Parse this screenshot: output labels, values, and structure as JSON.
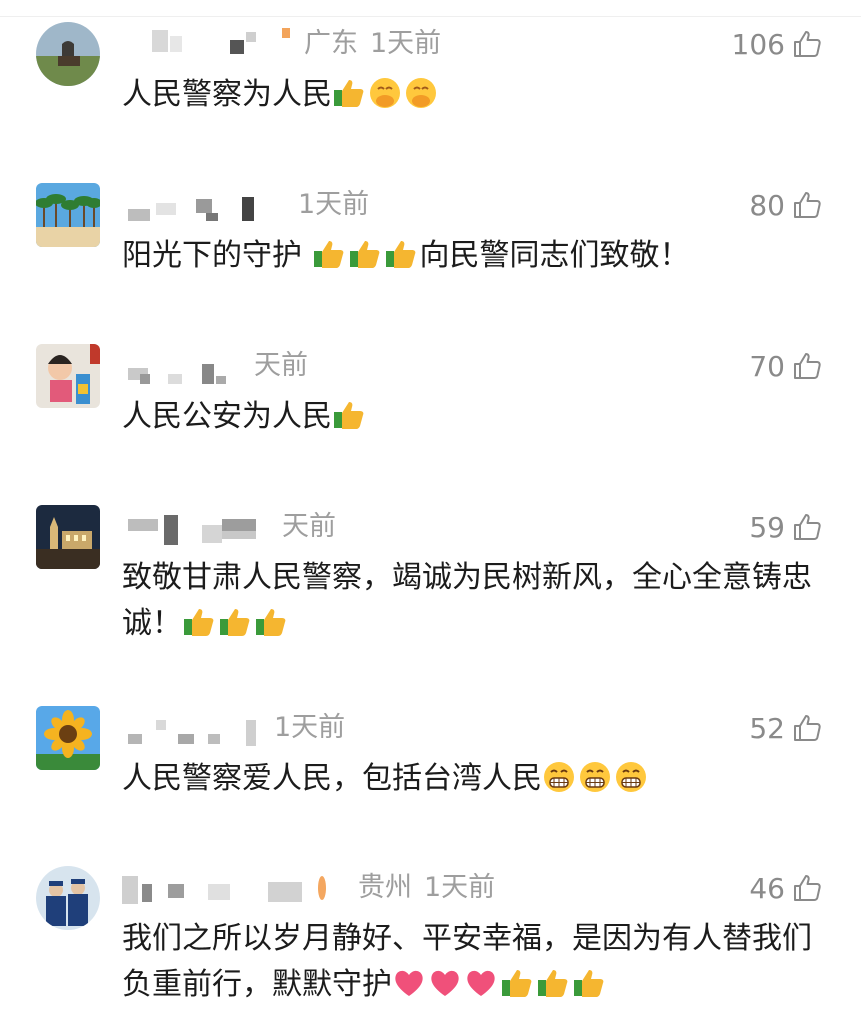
{
  "comments": [
    {
      "location": "广东",
      "time": "1天前",
      "likes": "106",
      "text": "人民警察为人民",
      "emojis": [
        "thumbs-up",
        "face-with-hand-over-mouth",
        "face-with-hand-over-mouth"
      ]
    },
    {
      "location": "",
      "time": "1天前",
      "likes": "80",
      "text": "阳光下的守护 ",
      "emojis_mid": [
        "thumbs-up",
        "thumbs-up",
        "thumbs-up"
      ],
      "text2": "向民警同志们致敬！"
    },
    {
      "location": "",
      "time": "天前",
      "likes": "70",
      "text": "人民公安为人民",
      "emojis": [
        "thumbs-up"
      ]
    },
    {
      "location": "",
      "time": "天前",
      "likes": "59",
      "text": "致敬甘肃人民警察，竭诚为民树新风，全心全意铸忠诚！",
      "emojis": [
        "thumbs-up",
        "thumbs-up",
        "thumbs-up"
      ]
    },
    {
      "location": "",
      "time": "1天前",
      "likes": "52",
      "text": "人民警察爱人民，包括台湾人民",
      "emojis": [
        "grinning-face",
        "grinning-face",
        "grinning-face"
      ]
    },
    {
      "location": "贵州",
      "time": "1天前",
      "likes": "46",
      "text": "我们之所以岁月静好、平安幸福，是因为有人替我们负重前行，默默守护",
      "emojis": [
        "heart",
        "heart",
        "heart",
        "thumbs-up",
        "thumbs-up",
        "thumbs-up"
      ]
    }
  ]
}
